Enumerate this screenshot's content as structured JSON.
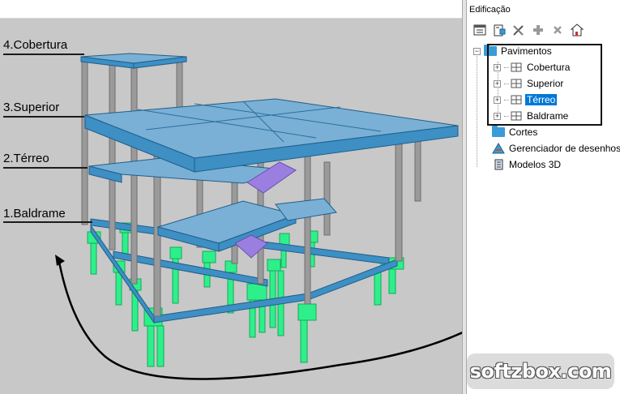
{
  "panel": {
    "title": "Edificação",
    "toolbar": [
      {
        "icon": "tree-view-icon"
      },
      {
        "icon": "building-settings-icon"
      },
      {
        "icon": "tools-icon"
      },
      {
        "icon": "add-structure-icon"
      },
      {
        "icon": "delete-icon"
      },
      {
        "icon": "house-export-icon"
      }
    ],
    "tree": {
      "pavimentos": "Pavimentos",
      "floors": [
        "Cobertura",
        "Superior",
        "Térreo",
        "Baldrame"
      ],
      "selected": "Térreo",
      "cortes": "Cortes",
      "gerenciador": "Gerenciador de desenhos",
      "modelos": "Modelos 3D"
    }
  },
  "viewport": {
    "floor_labels": [
      "4.Cobertura",
      "3.Superior",
      "2.Térreo",
      "1.Baldrame"
    ]
  },
  "watermark": "softzbox.com",
  "colors": {
    "beam": "#3d8fc4",
    "slab": "#7ab0d6",
    "column": "#9a9a9a",
    "foundation": "#2ef08a",
    "stair": "#9b7fe0",
    "selection": "#0078d7"
  }
}
